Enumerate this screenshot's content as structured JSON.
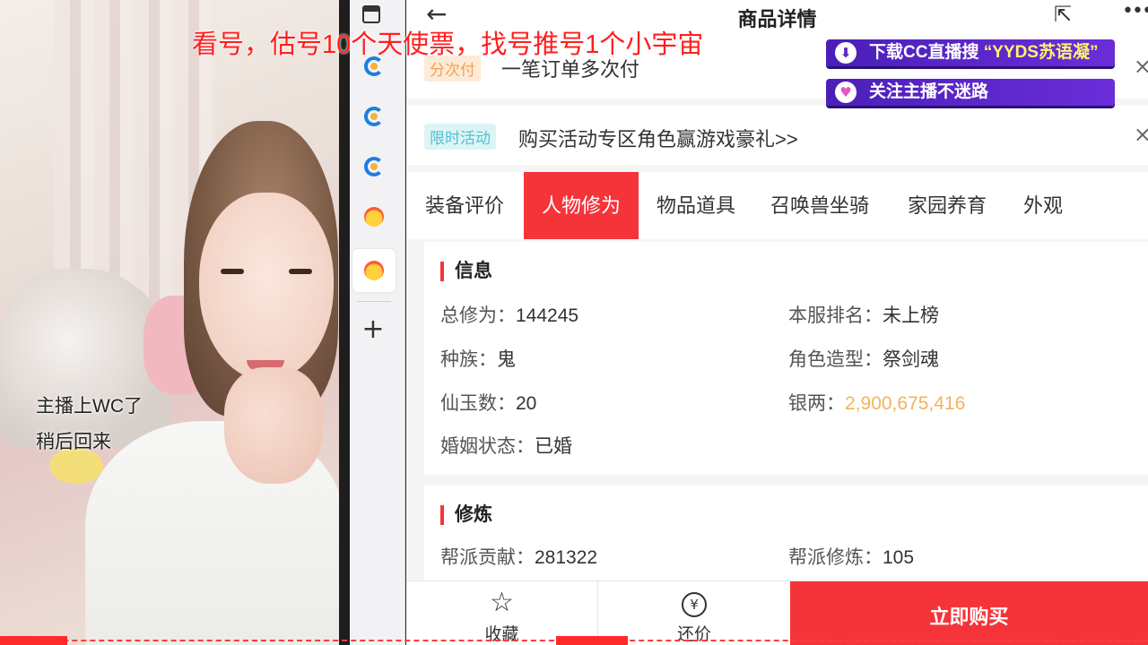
{
  "stream": {
    "overlay_title": "看号，估号10个天使票，找号推号1个小宇宙",
    "cam_text_line1": "主播上WC了",
    "cam_text_line2": "稍后回来",
    "banner1": {
      "prefix": "下载CC直播搜 ",
      "highlight": "“YYDS苏语凝”"
    },
    "banner2": "关注主播不迷路",
    "accent_color": "#ff1e1e",
    "banner_color": "#5b27c6"
  },
  "browser": {
    "tab_icons": [
      "window-icon",
      "cc-icon",
      "cc-icon",
      "cc-icon",
      "chick-icon",
      "chick-icon"
    ],
    "new_tab_label": "+"
  },
  "product": {
    "back_label": "←",
    "title": "商品详情",
    "share_label": "⇱",
    "more_label": "•••",
    "installment": {
      "badge": "分次付",
      "text": "一笔订单多次付",
      "close": "×"
    },
    "promo": {
      "badge": "限时活动",
      "text": "购买活动专区角色赢游戏豪礼>>",
      "close": "×"
    },
    "tabs": [
      {
        "label": "装备评价",
        "active": false
      },
      {
        "label": "人物修为",
        "active": true
      },
      {
        "label": "物品道具",
        "active": false
      },
      {
        "label": "召唤兽坐骑",
        "active": false
      },
      {
        "label": "家园养育",
        "active": false
      },
      {
        "label": "外观",
        "active": false
      }
    ],
    "info": {
      "heading": "信息",
      "total_cultivation_label": "总修为：",
      "total_cultivation": "144245",
      "server_rank_label": "本服排名：",
      "server_rank": "未上榜",
      "race_label": "种族：",
      "race": "鬼",
      "character_label": "角色造型：",
      "character": "祭剑魂",
      "jade_label": "仙玉数：",
      "jade": "20",
      "silver_label": "银两：",
      "silver": "2,900,675,416",
      "marriage_label": "婚姻状态：",
      "marriage": "已婚"
    },
    "training": {
      "heading": "修炼",
      "guild_contrib_label": "帮派贡献：",
      "guild_contrib": "281322",
      "guild_training_label": "帮派修炼：",
      "guild_training": "105"
    },
    "bottom": {
      "favorite": "收藏",
      "bargain": "还价",
      "buy": "立即购买",
      "buy_color": "#f5343a"
    },
    "silver_color": "#f3b35a"
  }
}
